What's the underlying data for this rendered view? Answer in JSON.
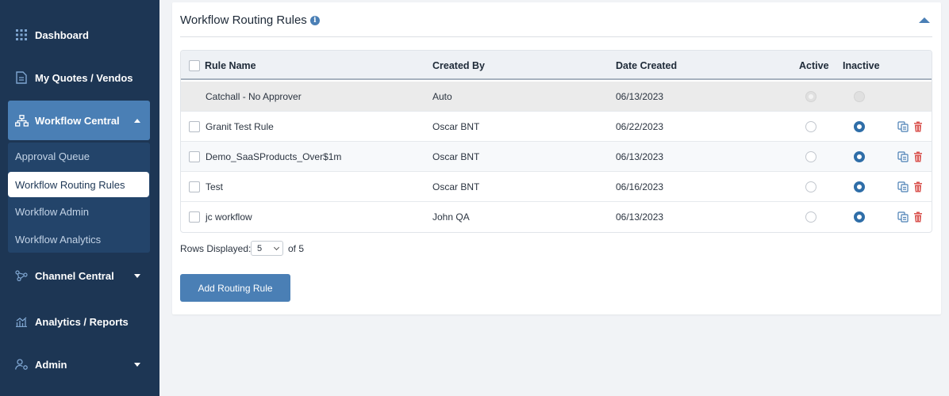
{
  "sidebar": {
    "items": [
      {
        "label": "Dashboard",
        "icon": "grid-icon"
      },
      {
        "label": "My Quotes / Vendos",
        "icon": "document-icon"
      },
      {
        "label": "Workflow Central",
        "icon": "sitemap-icon"
      },
      {
        "label": "Channel Central",
        "icon": "network-icon"
      },
      {
        "label": "Analytics / Reports",
        "icon": "bar-chart-icon"
      },
      {
        "label": "Admin",
        "icon": "user-settings-icon"
      }
    ],
    "submenu": [
      "Approval Queue",
      "Workflow Routing Rules",
      "Workflow Admin",
      "Workflow Analytics"
    ],
    "selected_submenu": "Workflow Routing Rules"
  },
  "panel": {
    "title": "Workflow Routing Rules",
    "info_glyph": "i"
  },
  "table": {
    "columns": [
      "Rule Name",
      "Created By",
      "Date Created",
      "Active",
      "Inactive"
    ],
    "rows": [
      {
        "name": "Catchall - No Approver",
        "created_by": "Auto",
        "date": "06/13/2023",
        "status": "locked"
      },
      {
        "name": "Granit Test Rule",
        "created_by": "Oscar BNT",
        "date": "06/22/2023",
        "status": "inactive"
      },
      {
        "name": "Demo_SaaSProducts_Over$1m",
        "created_by": "Oscar BNT",
        "date": "06/13/2023",
        "status": "inactive"
      },
      {
        "name": "Test",
        "created_by": "Oscar BNT",
        "date": "06/16/2023",
        "status": "inactive"
      },
      {
        "name": "jc workflow",
        "created_by": "John QA",
        "date": "06/13/2023",
        "status": "inactive"
      }
    ]
  },
  "pagination": {
    "label": "Rows Displayed:",
    "value": "5",
    "of_text": "of 5"
  },
  "actions": {
    "add_label": "Add Routing Rule"
  },
  "colors": {
    "sidebar": "#1d3654",
    "accent": "#4a7fb5",
    "radio_selected": "#2f6ea8",
    "delete": "#d9534f"
  }
}
